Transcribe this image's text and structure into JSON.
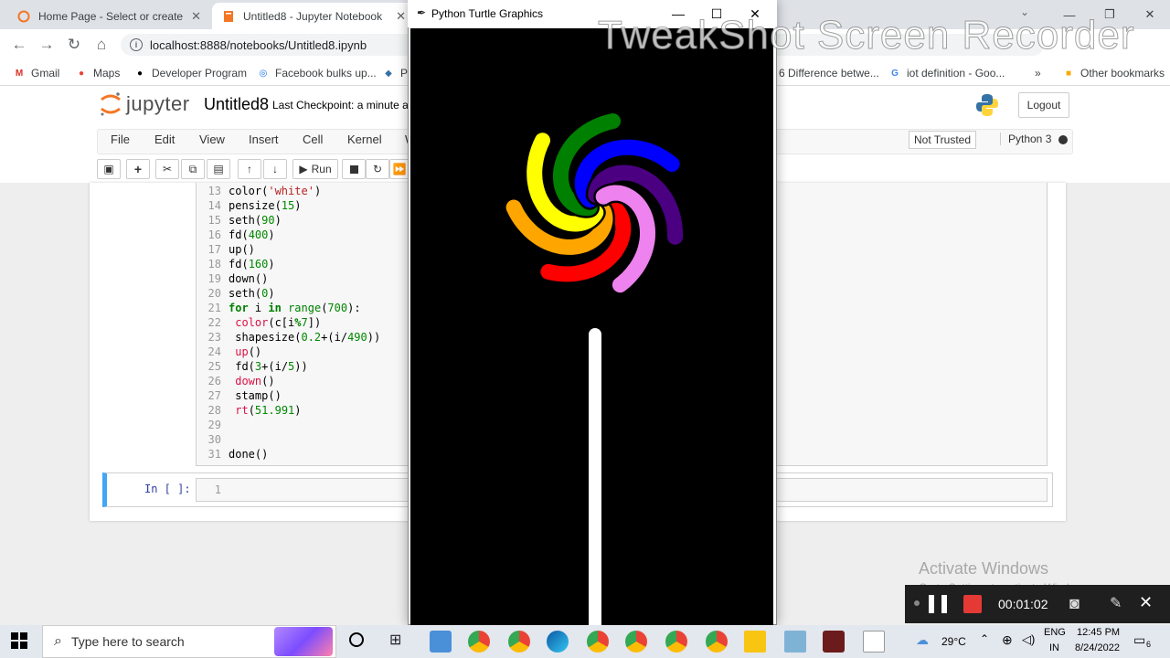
{
  "browser": {
    "tabs": [
      {
        "label": "Home Page - Select or create a n",
        "active": false
      },
      {
        "label": "Untitled8 - Jupyter Notebook",
        "active": true
      }
    ],
    "url": "localhost:8888/notebooks/Untitled8.ipynb",
    "bookmarks": [
      {
        "label": "Gmail",
        "icon": "gmail-icon"
      },
      {
        "label": "Maps",
        "icon": "maps-icon"
      },
      {
        "label": "Developer Program",
        "icon": "github-icon"
      },
      {
        "label": "Facebook bulks up...",
        "icon": "globe-icon"
      },
      {
        "label": "P",
        "icon": "python-icon"
      },
      {
        "label": "6 Difference betwe...",
        "icon": "page-icon"
      },
      {
        "label": "iot definition - Goo...",
        "icon": "google-icon"
      },
      {
        "label": "Other bookmarks",
        "icon": "folder-icon"
      }
    ],
    "more_bookmarks": "»"
  },
  "jupyter": {
    "logo_text": "jupyter",
    "notebook_name": "Untitled8",
    "checkpoint": "Last Checkpoint: a minute a",
    "logout_label": "Logout",
    "menu": [
      "File",
      "Edit",
      "View",
      "Insert",
      "Cell",
      "Kernel",
      "W"
    ],
    "trust_label": "Not Trusted",
    "kernel_label": "Python 3",
    "run_label": "Run",
    "code_lines": [
      {
        "n": "13",
        "text": "color('white')"
      },
      {
        "n": "14",
        "text": "pensize(15)"
      },
      {
        "n": "15",
        "text": "seth(90)"
      },
      {
        "n": "16",
        "text": "fd(400)"
      },
      {
        "n": "17",
        "text": "up()"
      },
      {
        "n": "18",
        "text": "fd(160)"
      },
      {
        "n": "19",
        "text": "down()"
      },
      {
        "n": "20",
        "text": "seth(0)"
      },
      {
        "n": "21",
        "text": "for i in range(700):"
      },
      {
        "n": "22",
        "text": " color(c[i%7])"
      },
      {
        "n": "23",
        "text": " shapesize(0.2+(i/490))"
      },
      {
        "n": "24",
        "text": " up()"
      },
      {
        "n": "25",
        "text": " fd(3+(i/5))"
      },
      {
        "n": "26",
        "text": " down()"
      },
      {
        "n": "27",
        "text": " stamp()"
      },
      {
        "n": "28",
        "text": " rt(51.991)"
      },
      {
        "n": "29",
        "text": ""
      },
      {
        "n": "30",
        "text": ""
      },
      {
        "n": "31",
        "text": "done()"
      }
    ],
    "empty_cell_prompt": "In [ ]:",
    "empty_cell_line": "1"
  },
  "turtle_window": {
    "title": "Python Turtle Graphics",
    "spiral_colors": [
      "#ff0000",
      "#ffa500",
      "#ffff00",
      "#008000",
      "#0000ff",
      "#4b0082",
      "#ee82ee"
    ],
    "background": "#000000",
    "stick_color": "#ffffff"
  },
  "overlay": {
    "watermark": "TweakShot Screen Recorder",
    "activate_title": "Activate Windows",
    "activate_sub": "Go to Settings to activate Windows.",
    "recording_time": "00:01:02"
  },
  "taskbar": {
    "search_placeholder": "Type here to search",
    "temperature": "29°C",
    "language": "ENG",
    "region": "IN",
    "time": "12:45 PM",
    "date": "8/24/2022",
    "notifications": "6"
  }
}
